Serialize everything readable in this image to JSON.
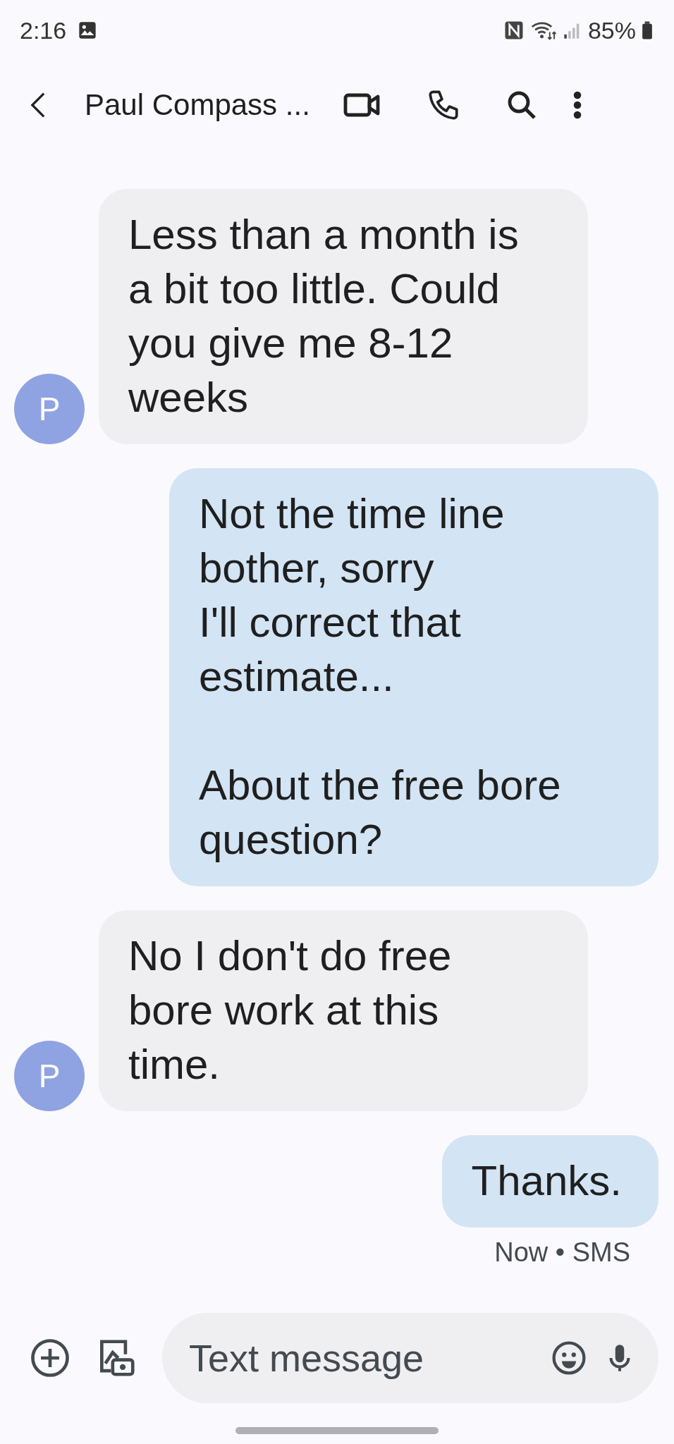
{
  "status_bar": {
    "time": "2:16",
    "battery": "85%"
  },
  "header": {
    "title": "Paul Compass ..."
  },
  "messages": [
    {
      "kind": "incoming",
      "avatar": "P",
      "text": "Less than a month is a bit too little. Could you give me 8-12 weeks"
    },
    {
      "kind": "outgoing",
      "text": "Not the time line bother, sorry\nI'll correct that estimate...\n\nAbout the free bore question?"
    },
    {
      "kind": "incoming",
      "avatar": "P",
      "text": "No I don't do free bore work at this time."
    },
    {
      "kind": "outgoing",
      "text": "Thanks.",
      "meta": "Now • SMS"
    }
  ],
  "composer": {
    "placeholder": "Text message"
  }
}
